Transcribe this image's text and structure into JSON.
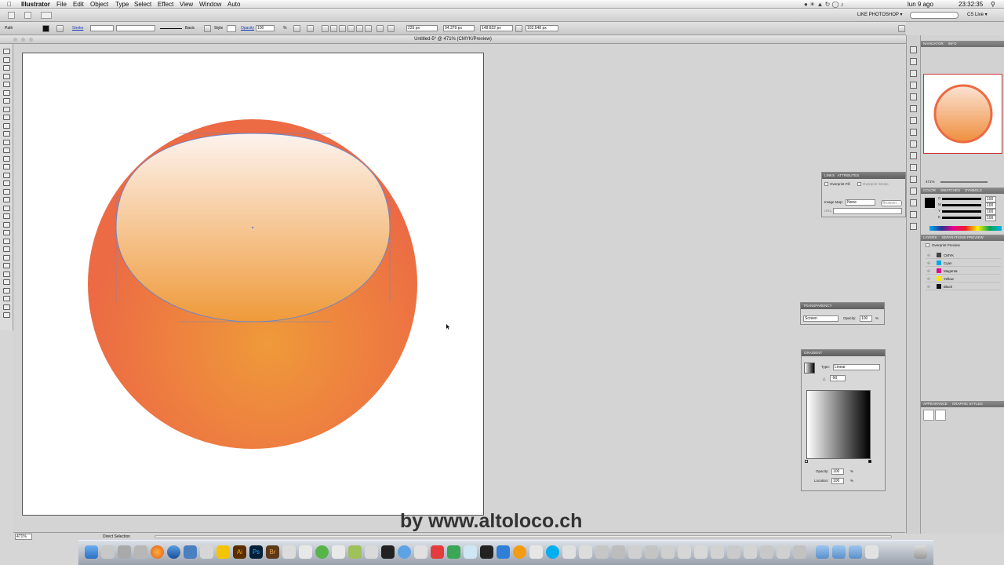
{
  "menubar": {
    "app_name": "Illustrator",
    "items": [
      "File",
      "Edit",
      "Object",
      "Type",
      "Select",
      "Effect",
      "View",
      "Window",
      "Auto"
    ],
    "clock_date": "lun 9 ago",
    "clock_time": "23:32:35"
  },
  "appbar": {
    "workspace": "LIKE PHOTOSHOP ▾",
    "cs_live": "CS Live ▾"
  },
  "controlbar": {
    "selection_type": "Path",
    "stroke_label": "Stroke",
    "stroke_profile": "Basic",
    "style_label": "Style",
    "opacity_label": "Opacity",
    "opacity_value": "100",
    "opacity_unit": "%",
    "x_value": "225 px",
    "y_value": "94.379 px",
    "w_value": "148.832 px",
    "h_value": "102.548 px"
  },
  "document": {
    "title": "Untitled-5* @ 471% (CMYK/Preview)",
    "zoom": "471%",
    "status_tool": "Direct Selection"
  },
  "navigator": {
    "tabs": [
      "NAVIGATOR",
      "INFO"
    ],
    "zoom": "471%"
  },
  "color_panel": {
    "tabs": [
      "COLOR",
      "SWATCHES",
      "SYMBOLS"
    ],
    "channels": [
      "C",
      "M",
      "Y",
      "K"
    ],
    "values": [
      "100",
      "100",
      "100",
      "100"
    ]
  },
  "layers_panel": {
    "tabs": [
      "LAYERS",
      "SEPARATIONS PREVIEW"
    ],
    "overprint_label": "Overprint Preview",
    "inks": [
      {
        "name": "CMYK",
        "color": "#444444"
      },
      {
        "name": "Cyan",
        "color": "#00a8e8"
      },
      {
        "name": "Magenta",
        "color": "#e2008a"
      },
      {
        "name": "Yellow",
        "color": "#ffe600"
      },
      {
        "name": "Black",
        "color": "#111111"
      }
    ]
  },
  "appearance_panel": {
    "tabs": [
      "APPEARANCE",
      "GRAPHIC STYLES"
    ]
  },
  "attributes_panel": {
    "tabs": [
      "LINKS",
      "ATTRIBUTES"
    ],
    "overprint_fill": "Overprint Fill",
    "overprint_stroke": "Overprint Stroke",
    "image_map_label": "Image Map:",
    "image_map_value": "None",
    "browser_label": "Browser...",
    "url_label": "URL:"
  },
  "transparency_panel": {
    "title": "TRANSPARENCY",
    "blend_mode": "Screen",
    "opacity_label": "Opacity:",
    "opacity_value": "100",
    "unit": "%"
  },
  "gradient_panel": {
    "title": "GRADIENT",
    "type_label": "Type:",
    "type_value": "Linear",
    "angle_value": "-90",
    "opacity_label": "Opacity:",
    "opacity_value": "100",
    "location_label": "Location:",
    "location_value": "100",
    "unit": "%"
  },
  "watermark": "by www.altoloco.ch",
  "colors": {
    "sphere_outer": "#ec6a44",
    "sphere_inner": "#ef9a3a",
    "highlight_top": "#fdf3ee",
    "highlight_bottom": "#ef9a3a",
    "path_outline": "#6f86c8"
  }
}
